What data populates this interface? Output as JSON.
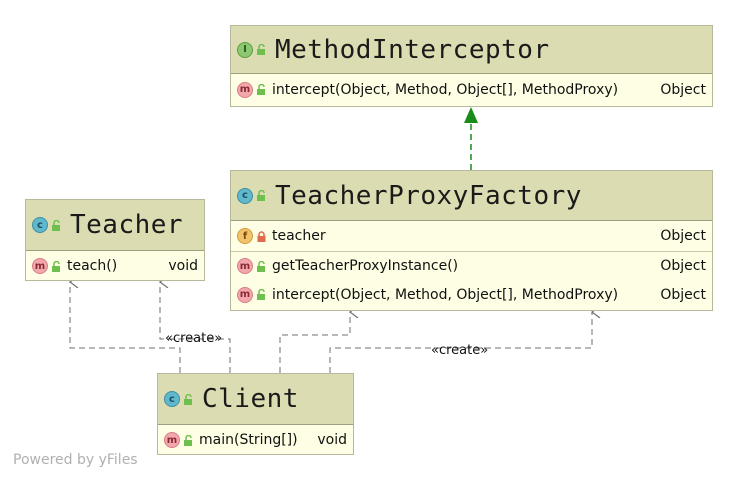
{
  "classes": {
    "method_interceptor": {
      "name": "MethodInterceptor",
      "kind_icon": "interface-icon",
      "members": [
        {
          "kind": "m",
          "signature": "intercept(Object, Method, Object[], MethodProxy)",
          "type": "Object"
        }
      ]
    },
    "teacher_proxy_factory": {
      "name": "TeacherProxyFactory",
      "kind_icon": "class-icon",
      "fields": [
        {
          "kind": "f",
          "signature": "teacher",
          "type": "Object"
        }
      ],
      "members": [
        {
          "kind": "m",
          "signature": "getTeacherProxyInstance()",
          "type": "Object"
        },
        {
          "kind": "m",
          "signature": "intercept(Object, Method, Object[], MethodProxy)",
          "type": "Object"
        }
      ]
    },
    "teacher": {
      "name": "Teacher",
      "kind_icon": "class-icon",
      "members": [
        {
          "kind": "m",
          "signature": "teach()",
          "type": "void"
        }
      ]
    },
    "client": {
      "name": "Client",
      "kind_icon": "class-icon",
      "members": [
        {
          "kind": "m",
          "signature": "main(String[])",
          "type": "void"
        }
      ]
    }
  },
  "badges": {
    "interface": "I",
    "class": "c",
    "method": "m",
    "field": "f"
  },
  "edges": {
    "create_label_left": "«create»",
    "create_label_right": "«create»"
  },
  "colors": {
    "realization": "#1a8c1a",
    "dependency": "#707070",
    "header_bg": "#dcdcb2",
    "body_bg": "#fefee4"
  },
  "footer": {
    "credit": "Powered by yFiles"
  }
}
